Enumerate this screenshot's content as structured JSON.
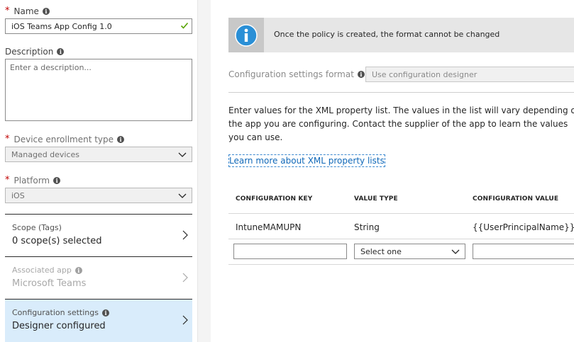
{
  "left_panel": {
    "name": {
      "label": "Name",
      "required": "*",
      "value": "iOS Teams App Config 1.0"
    },
    "description": {
      "label": "Description",
      "placeholder": "Enter a description..."
    },
    "device_enrollment_type": {
      "label": "Device enrollment type",
      "required": "*",
      "value": "Managed devices"
    },
    "platform": {
      "label": "Platform",
      "required": "*",
      "value": "iOS"
    },
    "scope": {
      "title": "Scope (Tags)",
      "value": "0 scope(s) selected"
    },
    "associated_app": {
      "title": "Associated app",
      "value": "Microsoft Teams"
    },
    "configuration_settings": {
      "title": "Configuration settings",
      "value": "Designer configured"
    }
  },
  "right_panel": {
    "banner_text": "Once the policy is created, the format cannot be changed",
    "format_label": "Configuration settings format",
    "format_value": "Use configuration designer",
    "description": "Enter values for the XML property list. The values in the list will vary depending on the app you are configuring. Contact the supplier of the app to learn the values you can use.",
    "learn_more_link": "Learn more about XML property lists",
    "table": {
      "headers": [
        "CONFIGURATION KEY",
        "VALUE TYPE",
        "CONFIGURATION VALUE"
      ],
      "rows": [
        {
          "key": "IntuneMAMUPN",
          "type": "String",
          "value": "{{UserPrincipalName}}"
        }
      ],
      "new_row_type_placeholder": "Select one"
    }
  },
  "colors": {
    "selected_bg": "#d9ecfb",
    "link": "#1068b8",
    "required": "#c00000",
    "check": "#57a300",
    "info_blue": "#2a8fd6"
  },
  "icons": [
    "info-icon",
    "checkmark-icon",
    "chevron-down-icon",
    "chevron-right-icon",
    "info-circle-icon"
  ]
}
